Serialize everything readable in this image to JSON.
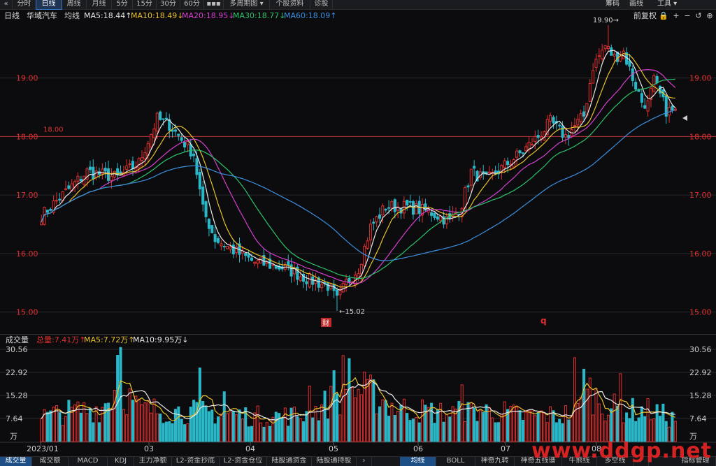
{
  "toolbar": {
    "back": "«",
    "tabs": [
      "分时",
      "日线",
      "周线",
      "月线",
      "5分",
      "15分",
      "30分",
      "60分",
      "▪▪▪",
      "多周期图 ▾",
      "个股资料",
      "诊股"
    ],
    "active": 1,
    "right": [
      "筹码",
      "画线",
      "工具 ▾"
    ]
  },
  "legend": {
    "period": "日线",
    "name": "华域汽车",
    "label": "均线",
    "ma5": "MA5:18.44↑",
    "ma10": "MA10:18.49↓",
    "ma20": "MA20:18.95↓",
    "ma30": "MA30:18.77↓",
    "ma60": "MA60:18.09↑",
    "adjust": "前复权",
    "icons": [
      "lock-icon",
      "plus-icon",
      "minus-icon",
      "undo-icon",
      "zoom-in-icon",
      "zoom-out-icon"
    ],
    "icon_glyphs": [
      "🔒",
      "+",
      "−",
      "↺",
      "⊕",
      "⊖"
    ]
  },
  "volume_header": {
    "title": "成交量",
    "total": "总量:7.41万↑",
    "ma5": "MA5:7.72万↑",
    "ma10": "MA10:9.95万↓"
  },
  "bottom_tabs": {
    "left": [
      "成交量",
      "成交额",
      "MACD",
      "KDJ",
      "主力净额",
      "L2-资金抄底",
      "L2-资金仓位",
      "陆股通资金",
      "陆股通持股",
      "›"
    ],
    "left_active": 0,
    "right": [
      "均线",
      "BOLL",
      "神奇九转",
      "神奇五线谱",
      "牛熊线",
      "多空线",
      "›",
      "指标管理"
    ],
    "right_active": 0
  },
  "watermark": "www.ddgp.net",
  "chart_data": {
    "type": "candlestick",
    "price_axis": {
      "ylim": [
        14.9,
        19.95
      ],
      "ticks": [
        15.0,
        16.0,
        17.0,
        18.0,
        19.0
      ],
      "tick_labels": [
        "15.00",
        "16.00",
        "17.00",
        "18.00",
        "19.00"
      ]
    },
    "volume_axis": {
      "ylim": [
        0,
        31.5
      ],
      "ticks": [
        7.64,
        15.28,
        22.92,
        30.56
      ],
      "tick_labels": [
        "7.64",
        "15.28",
        "22.92",
        "30.56"
      ],
      "unit": "万"
    },
    "reference_line": {
      "value": 18.0,
      "label": "18.00"
    },
    "high_annotation": {
      "label": "19.90→",
      "value": 19.9
    },
    "low_annotation": {
      "label": "←15.02",
      "value": 15.02
    },
    "event_markers": [
      {
        "label": "财",
        "month": "05"
      },
      {
        "label": "q",
        "month": "06"
      }
    ],
    "months": [
      "2023/01",
      "03",
      "04",
      "05",
      "06",
      "07",
      "08"
    ],
    "anchors": [
      [
        0,
        16.65
      ],
      [
        5,
        16.9
      ],
      [
        15,
        17.4
      ],
      [
        25,
        17.3
      ],
      [
        32,
        17.55
      ],
      [
        38,
        18.3
      ],
      [
        42,
        18.2
      ],
      [
        46,
        17.95
      ],
      [
        50,
        17.7
      ],
      [
        53,
        16.75
      ],
      [
        57,
        16.25
      ],
      [
        63,
        16.05
      ],
      [
        70,
        15.85
      ],
      [
        80,
        15.75
      ],
      [
        88,
        15.55
      ],
      [
        94,
        15.45
      ],
      [
        97,
        15.2
      ],
      [
        100,
        15.5
      ],
      [
        104,
        15.75
      ],
      [
        108,
        16.45
      ],
      [
        113,
        16.8
      ],
      [
        120,
        16.8
      ],
      [
        128,
        16.7
      ],
      [
        134,
        16.55
      ],
      [
        138,
        16.85
      ],
      [
        141,
        17.4
      ],
      [
        146,
        17.25
      ],
      [
        152,
        17.5
      ],
      [
        158,
        17.75
      ],
      [
        163,
        18.0
      ],
      [
        167,
        18.25
      ],
      [
        172,
        18.0
      ],
      [
        178,
        18.35
      ],
      [
        181,
        19.2
      ],
      [
        185,
        19.55
      ],
      [
        188,
        19.35
      ],
      [
        191,
        19.45
      ],
      [
        194,
        19.0
      ],
      [
        197,
        18.6
      ],
      [
        199,
        18.55
      ],
      [
        201,
        18.95
      ],
      [
        205,
        18.45
      ],
      [
        208,
        18.42
      ]
    ],
    "volume_levels": [
      [
        0,
        8.5
      ],
      [
        10,
        10.2
      ],
      [
        20,
        11.5
      ],
      [
        25,
        19
      ],
      [
        29,
        14.5
      ],
      [
        32,
        11
      ],
      [
        40,
        10.5
      ],
      [
        50,
        10
      ],
      [
        60,
        9.5
      ],
      [
        70,
        8.5
      ],
      [
        82,
        8.8
      ],
      [
        88,
        9.2
      ],
      [
        96,
        14.5
      ],
      [
        104,
        17.5
      ],
      [
        110,
        15.5
      ],
      [
        116,
        11.5
      ],
      [
        124,
        10.5
      ],
      [
        134,
        9.5
      ],
      [
        144,
        10.5
      ],
      [
        152,
        9.8
      ],
      [
        158,
        8.5
      ],
      [
        166,
        9
      ],
      [
        170,
        8.5
      ],
      [
        176,
        11
      ],
      [
        180,
        17
      ],
      [
        185,
        12
      ],
      [
        192,
        10.5
      ],
      [
        200,
        10.5
      ],
      [
        208,
        7.4
      ]
    ],
    "volume_peaks": [
      [
        26,
        31.2
      ],
      [
        25,
        28.6
      ],
      [
        52,
        24.4
      ],
      [
        88,
        18.4
      ],
      [
        96,
        23.5
      ],
      [
        99,
        28.5
      ],
      [
        101,
        27.5
      ],
      [
        175,
        27.8
      ],
      [
        178,
        24
      ],
      [
        190,
        22.5
      ],
      [
        138,
        18.8
      ],
      [
        60,
        16.5
      ]
    ],
    "moving_averages": [
      {
        "name": "MA5",
        "period": 5,
        "color": "#e8e8e8"
      },
      {
        "name": "MA10",
        "period": 10,
        "color": "#e8c12a"
      },
      {
        "name": "MA20",
        "period": 20,
        "color": "#d63fd0"
      },
      {
        "name": "MA30",
        "period": 30,
        "color": "#2cc36b"
      },
      {
        "name": "MA60",
        "period": 60,
        "color": "#3b8fe0"
      }
    ],
    "volume_mas": [
      {
        "name": "MA5",
        "period": 5,
        "color": "#e8c12a"
      },
      {
        "name": "MA10",
        "period": 10,
        "color": "#e8e8e8"
      }
    ],
    "colors": {
      "up": "#e03030",
      "down": "#2ab8c9",
      "grid": "#2a2a2e",
      "axis_text": "#e03030",
      "vol_axis_text": "#cfcfcf"
    }
  }
}
